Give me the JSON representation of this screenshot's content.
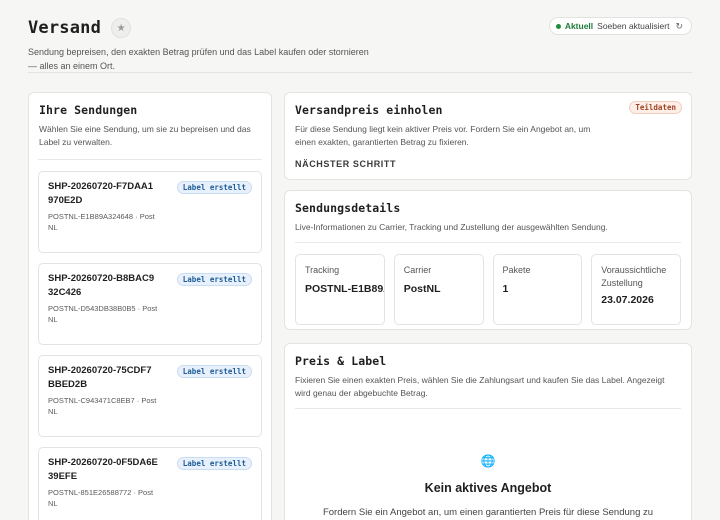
{
  "header": {
    "title": "Versand",
    "star_icon": "★",
    "subtitle": "Sendung bepreisen, den exakten Betrag prüfen und das Label kaufen oder stornieren — alles an einem Ort.",
    "status_live": "Aktuell",
    "status_text": "Soeben aktualisiert",
    "refresh_icon": "↻"
  },
  "shipments": {
    "title": "Ihre Sendungen",
    "subtitle": "Wählen Sie eine Sendung, um sie zu bepreisen und das Label zu verwalten.",
    "items": [
      {
        "id": "SHP-20260720-F7DAA1970E2D",
        "meta": "POSTNL-E1B89A324648 · PostNL",
        "badge": "Label erstellt"
      },
      {
        "id": "SHP-20260720-B8BAC932C426",
        "meta": "POSTNL-D543DB38B0B5 · PostNL",
        "badge": "Label erstellt"
      },
      {
        "id": "SHP-20260720-75CDF7BBED2B",
        "meta": "POSTNL-C943471C8EB7 · PostNL",
        "badge": "Label erstellt"
      },
      {
        "id": "SHP-20260720-0F5DA6E39EFE",
        "meta": "POSTNL-851E26588772 · PostNL",
        "badge": "Label erstellt"
      }
    ]
  },
  "quote": {
    "title": "Versandpreis einholen",
    "badge": "Teildaten",
    "subtitle": "Für diese Sendung liegt kein aktiver Preis vor. Fordern Sie ein Angebot an, um einen exakten, garantierten Betrag zu fixieren.",
    "next_step": "NÄCHSTER SCHRITT"
  },
  "details": {
    "title": "Sendungsdetails",
    "subtitle": "Live-Informationen zu Carrier, Tracking und Zustellung der ausgewählten Sendung.",
    "tiles": [
      {
        "label": "Tracking",
        "value": "POSTNL-E1B89A324648"
      },
      {
        "label": "Carrier",
        "value": "PostNL"
      },
      {
        "label": "Pakete",
        "value": "1"
      },
      {
        "label": "Voraussichtliche Zustellung",
        "value": "23.07.2026"
      }
    ]
  },
  "price": {
    "title": "Preis & Label",
    "subtitle": "Fixieren Sie einen exakten Preis, wählen Sie die Zahlungsart und kaufen Sie das Label. Angezeigt wird genau der abgebuchte Betrag.",
    "empty_icon": "🌐",
    "empty_title": "Kein aktives Angebot",
    "empty_text": "Fordern Sie ein Angebot an, um einen garantierten Preis für diese Sendung zu"
  }
}
